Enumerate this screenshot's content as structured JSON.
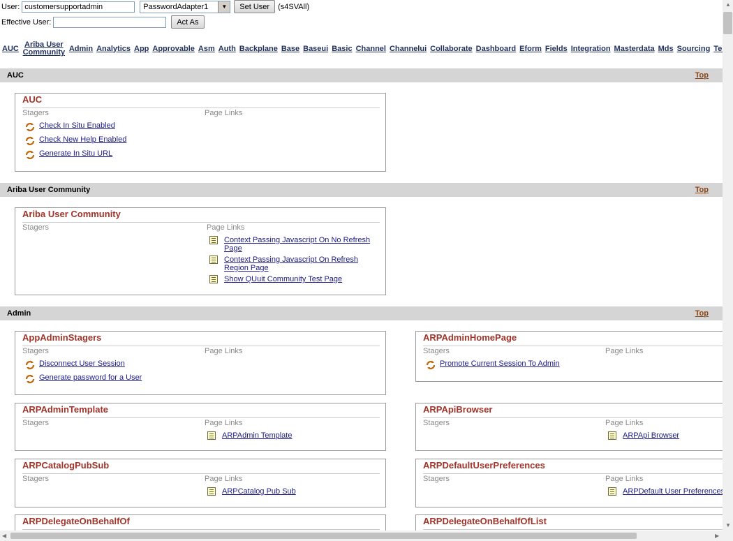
{
  "header": {
    "user_label": "User:",
    "user_value": "customersupportadmin",
    "adapter_value": "PasswordAdapter1",
    "set_user_label": "Set User",
    "realm_text": "(s4SVAll)",
    "effective_user_label": "Effective User:",
    "effective_user_value": "",
    "act_as_label": "Act As"
  },
  "nav": [
    {
      "label": "AUC"
    },
    {
      "label": "Ariba User Community"
    },
    {
      "label": "Admin"
    },
    {
      "label": "Analytics"
    },
    {
      "label": "App"
    },
    {
      "label": "Approvable"
    },
    {
      "label": "Asm"
    },
    {
      "label": "Auth"
    },
    {
      "label": "Backplane"
    },
    {
      "label": "Base"
    },
    {
      "label": "Baseui"
    },
    {
      "label": "Basic"
    },
    {
      "label": "Channel"
    },
    {
      "label": "Channelui"
    },
    {
      "label": "Collaborate"
    },
    {
      "label": "Dashboard"
    },
    {
      "label": "Eform"
    },
    {
      "label": "Fields"
    },
    {
      "label": "Integration"
    },
    {
      "label": "Masterdata"
    },
    {
      "label": "Mds"
    },
    {
      "label": "Sourcing"
    },
    {
      "label": "Testa"
    }
  ],
  "labels": {
    "stagers": "Stagers",
    "page_links": "Page Links",
    "top": "Top"
  },
  "sections": {
    "auc": {
      "title": "AUC",
      "box_title": "AUC",
      "stagers": [
        "Check In Situ Enabled",
        "Check New Help Enabled",
        "Generate In Situ URL"
      ]
    },
    "community": {
      "title": "Ariba User Community",
      "box_title": "Ariba User Community",
      "page_links": [
        "Context Passing Javascript On No Refresh Page",
        "Context Passing Javascript On Refresh Region Page",
        "Show QUuit Community Test Page"
      ]
    },
    "admin": {
      "title": "Admin",
      "boxes": {
        "app_admin_stagers": {
          "title": "AppAdminStagers",
          "stagers": [
            "Disconnect User Session",
            "Generate password for a User"
          ]
        },
        "arp_admin_home_page": {
          "title": "ARPAdminHomePage",
          "stagers": [
            "Promote Current Session To Admin"
          ]
        },
        "arp_admin_template": {
          "title": "ARPAdminTemplate",
          "page_links": [
            "ARPAdmin Template"
          ]
        },
        "arp_api_browser": {
          "title": "ARPApiBrowser",
          "page_links": [
            "ARPApi Browser"
          ]
        },
        "arp_catalog_pub_sub": {
          "title": "ARPCatalogPubSub",
          "page_links": [
            "ARPCatalog Pub Sub"
          ]
        },
        "arp_default_user_preferences": {
          "title": "ARPDefaultUserPreferences",
          "page_links": [
            "ARPDefault User Preferences"
          ]
        },
        "arp_delegate_on_behalf_of": {
          "title": "ARPDelegateOnBehalfOf"
        },
        "arp_delegate_on_behalf_of_list": {
          "title": "ARPDelegateOnBehalfOfList"
        }
      }
    }
  }
}
